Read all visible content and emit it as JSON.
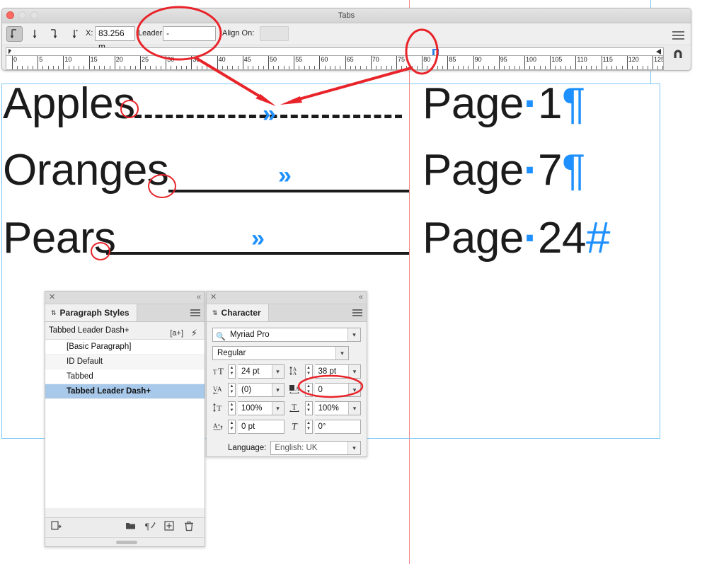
{
  "window": {
    "title": "Tabs",
    "traffic_lights": [
      "close",
      "minimize",
      "zoom"
    ]
  },
  "tabs_panel": {
    "align_buttons": [
      {
        "name": "left-tab",
        "glyph": "↓",
        "selected": true
      },
      {
        "name": "center-tab",
        "glyph": "↓",
        "selected": false
      },
      {
        "name": "right-tab",
        "glyph": "↓",
        "selected": false
      },
      {
        "name": "decimal-tab",
        "glyph": "↓",
        "selected": false
      }
    ],
    "x_label": "X:",
    "x_value": "83.256 m",
    "leader_label": "Leader:",
    "leader_value": "-",
    "align_on_label": "Align On:",
    "align_on_value": "",
    "menu_icon": "hamburger-icon",
    "magnet_icon": "magnet-snap-icon",
    "ruler": {
      "unit_labels": [
        "0",
        "5",
        "10",
        "15",
        "20",
        "25",
        "30",
        "35",
        "40",
        "45",
        "50",
        "55",
        "60",
        "65",
        "70",
        "75",
        "80",
        "85",
        "90",
        "95",
        "100",
        "105",
        "110",
        "115",
        "120",
        "125"
      ],
      "tab_stop_position": "83.256"
    }
  },
  "document": {
    "lines": [
      {
        "item": "Apples",
        "page": "Page",
        "space_dot": "·",
        "number": "1",
        "end_mark": "¶",
        "leader_style": "dashed",
        "tab_glyph": "»"
      },
      {
        "item": "Oranges",
        "page": "Page",
        "space_dot": "·",
        "number": "7",
        "end_mark": "¶",
        "leader_style": "solid",
        "tab_glyph": "»"
      },
      {
        "item": "Pears",
        "page": "Page",
        "space_dot": "·",
        "number": "24",
        "end_mark": "#",
        "leader_style": "solid",
        "tab_glyph": "»"
      }
    ]
  },
  "paragraph_styles_panel": {
    "close_icon": "✕",
    "collapse_icon": "«",
    "tab_label": "Paragraph Styles",
    "tab_caret": "⇅",
    "menu_icon": "panel-menu-icon",
    "current_style": "Tabbed Leader Dash+",
    "badge": "[a+]",
    "bolt": "⚡",
    "styles": [
      {
        "label": "[Basic Paragraph]",
        "selected": false
      },
      {
        "label": "ID Default",
        "selected": false
      },
      {
        "label": "Tabbed",
        "selected": false
      },
      {
        "label": "Tabbed Leader Dash+",
        "selected": true
      }
    ],
    "footer_icons": [
      {
        "name": "load-styles-icon",
        "glyph": "❐"
      },
      {
        "name": "new-style-group-icon",
        "glyph": "▬"
      },
      {
        "name": "clear-overrides-icon",
        "glyph": "¶"
      },
      {
        "name": "new-style-icon",
        "glyph": "⊞"
      },
      {
        "name": "delete-style-icon",
        "glyph": "🗑"
      }
    ]
  },
  "character_panel": {
    "close_icon": "✕",
    "collapse_icon": "«",
    "tab_label": "Character",
    "tab_caret": "⇅",
    "menu_icon": "panel-menu-icon",
    "font_family": "Myriad Pro",
    "font_style": "Regular",
    "font_size": "24 pt",
    "leading": "38 pt",
    "kerning": "(0)",
    "tracking": "0",
    "vertical_scale": "100%",
    "horizontal_scale": "100%",
    "baseline_shift": "0 pt",
    "skew": "0°",
    "language_label": "Language:",
    "language_value": "English: UK"
  },
  "annotations": {
    "accent_color": "#e8242a",
    "highlight_color": "#1e90ff",
    "ellipses": [
      {
        "name": "leader-field-highlight"
      },
      {
        "name": "ruler-tabstop-highlight"
      },
      {
        "name": "tracking-field-highlight"
      }
    ],
    "arrows": [
      {
        "name": "leader-to-tabmark-arrow"
      },
      {
        "name": "tabstop-to-tabmark-arrow"
      }
    ]
  }
}
